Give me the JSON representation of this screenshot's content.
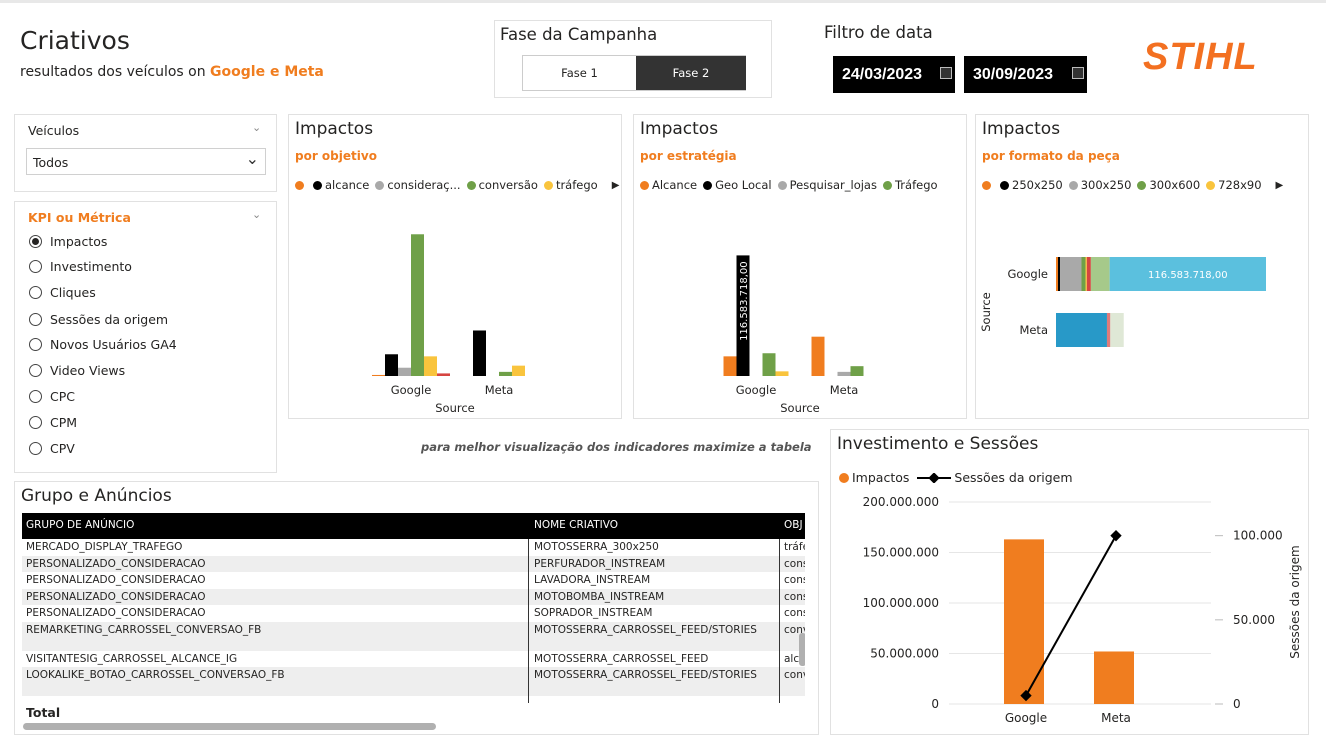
{
  "header": {
    "title": "Criativos",
    "subtitle_prefix": "resultados dos veículos on ",
    "subtitle_highlight": "Google e Meta",
    "logo": "STIHL"
  },
  "phase": {
    "title": "Fase da Campanha",
    "options": [
      "Fase 1",
      "Fase 2"
    ],
    "selected": "Fase 2"
  },
  "date_filter": {
    "title": "Filtro de data",
    "start": "24/03/2023",
    "end": "30/09/2023"
  },
  "vehicles_filter": {
    "label": "Veículos",
    "value": "Todos"
  },
  "kpi_filter": {
    "label": "KPI ou Métrica",
    "options": [
      "Impactos",
      "Investimento",
      "Cliques",
      "Sessões da origem",
      "Novos Usuários GA4",
      "Video Views",
      "CPC",
      "CPM",
      "CPV"
    ],
    "selected": "Impactos"
  },
  "chart_objetivo": {
    "title": "Impactos",
    "subtitle": "por objetivo",
    "legend": [
      "alcance",
      "consideraç...",
      "conversão",
      "tráfego"
    ],
    "legend_colors": [
      "#f07d1f",
      "#000000",
      "#a9a9a9",
      "#6fa048",
      "#f9c43d"
    ],
    "xlabel": "Source"
  },
  "chart_estrategia": {
    "title": "Impactos",
    "subtitle": "por estratégia",
    "legend": [
      "Alcance",
      "Geo Local",
      "Pesquisar_lojas",
      "Tráfego"
    ],
    "legend_colors": [
      "#f07d1f",
      "#000000",
      "#a9a9a9",
      "#6fa048"
    ],
    "xlabel": "Source",
    "data_label": "116.583.718,00"
  },
  "chart_formato": {
    "title": "Impactos",
    "subtitle": "por formato da peça",
    "legend": [
      "250x250",
      "300x250",
      "300x600",
      "728x90"
    ],
    "legend_colors": [
      "#f07d1f",
      "#000000",
      "#a9a9a9",
      "#6fa048",
      "#f9c43d"
    ],
    "ylabel": "Source",
    "data_label": "116.583.718,00"
  },
  "note": "para melhor visualização dos indicadores maximize a tabela",
  "chart_invest": {
    "title": "Investimento e Sessões",
    "legend_bar": "Impactos",
    "legend_line": "Sessões da origem",
    "y2label": "Sessões da origem",
    "yticks": [
      "200.000.000",
      "150.000.000",
      "100.000.000",
      "50.000.000",
      "0"
    ],
    "y2ticks": [
      "100.000",
      "50.000",
      "0"
    ]
  },
  "table": {
    "title": "Grupo e Anúncios",
    "columns": [
      "GRUPO DE ANÚNCIO",
      "NOME CRIATIVO",
      "OBJ"
    ],
    "rows": [
      [
        "MERCADO_DISPLAY_TRAFEGO",
        "MOTOSSERRA_300x250",
        "tráfe"
      ],
      [
        "PERSONALIZADO_CONSIDERACAO",
        "PERFURADOR_INSTREAM",
        "cons"
      ],
      [
        "PERSONALIZADO_CONSIDERACAO",
        "LAVADORA_INSTREAM",
        "cons"
      ],
      [
        "PERSONALIZADO_CONSIDERACAO",
        "MOTOBOMBA_INSTREAM",
        "cons"
      ],
      [
        "PERSONALIZADO_CONSIDERACAO",
        "SOPRADOR_INSTREAM",
        "cons"
      ],
      [
        "REMARKETING_CARROSSEL_CONVERSAO_FB",
        "MOTOSSERRA_CARROSSEL_FEED/STORIES",
        "conv"
      ],
      [
        "VISITANTESIG_CARROSSEL_ALCANCE_IG",
        "MOTOSSERRA_CARROSSEL_FEED",
        "alca"
      ],
      [
        "LOOKALIKE_BOTAO_CARROSSEL_CONVERSAO_FB",
        "MOTOSSERRA_CARROSSEL_FEED/STORIES",
        "conv"
      ]
    ],
    "total_label": "Total"
  },
  "chart_data": [
    {
      "type": "bar",
      "title": "Impactos",
      "subtitle": "por objetivo",
      "xlabel": "Source",
      "categories": [
        "Google",
        "Meta"
      ],
      "series": [
        {
          "name": "",
          "color": "#f07d1f",
          "values": [
            1000000,
            0
          ]
        },
        {
          "name": "alcance",
          "color": "#000000",
          "values": [
            21000000,
            44000000
          ]
        },
        {
          "name": "consideraç...",
          "color": "#a9a9a9",
          "values": [
            8000000,
            0
          ]
        },
        {
          "name": "conversão",
          "color": "#6fa048",
          "values": [
            137000000,
            4000000
          ]
        },
        {
          "name": "tráfego",
          "color": "#f9c43d",
          "values": [
            19000000,
            10000000
          ]
        },
        {
          "name": "",
          "color": "#d64541",
          "values": [
            2500000,
            0
          ]
        }
      ],
      "ylim": [
        0,
        145000000
      ]
    },
    {
      "type": "bar",
      "title": "Impactos",
      "subtitle": "por estratégia",
      "xlabel": "Source",
      "categories": [
        "Google",
        "Meta"
      ],
      "series": [
        {
          "name": "Alcance",
          "color": "#f07d1f",
          "values": [
            19000000,
            38000000
          ]
        },
        {
          "name": "Geo Local",
          "color": "#000000",
          "values": [
            116583718,
            0
          ]
        },
        {
          "name": "Pesquisar_lojas",
          "color": "#a9a9a9",
          "values": [
            0,
            4000000
          ]
        },
        {
          "name": "Tráfego",
          "color": "#6fa048",
          "values": [
            22000000,
            9500000
          ]
        },
        {
          "name": "",
          "color": "#f9c43d",
          "values": [
            4500000,
            0
          ]
        }
      ],
      "ylim": [
        0,
        145000000
      ],
      "data_labels": [
        "116.583.718,00"
      ]
    },
    {
      "type": "bar",
      "orientation": "horizontal-stacked",
      "title": "Impactos",
      "subtitle": "por formato da peça",
      "ylabel": "Source",
      "categories": [
        "Google",
        "Meta"
      ],
      "series": [
        {
          "name": "",
          "color": "#f07d1f",
          "values": [
            1500000,
            0
          ]
        },
        {
          "name": "250x250",
          "color": "#000000",
          "values": [
            1500000,
            0
          ]
        },
        {
          "name": "300x250",
          "color": "#a9a9a9",
          "values": [
            16000000,
            0
          ]
        },
        {
          "name": "300x600",
          "color": "#6fa048",
          "values": [
            3000000,
            0
          ]
        },
        {
          "name": "728x90",
          "color": "#f9c43d",
          "values": [
            1000000,
            0
          ]
        },
        {
          "name": "",
          "color": "#d64541",
          "values": [
            3000000,
            0
          ]
        },
        {
          "name": "",
          "color": "#a6c98a",
          "values": [
            14000000,
            0
          ]
        },
        {
          "name": "",
          "color": "#5bc0de",
          "values": [
            116583718,
            0
          ]
        },
        {
          "name": "",
          "color": "#2899c8",
          "values": [
            0,
            38000000
          ]
        },
        {
          "name": "",
          "color": "#e07b7b",
          "values": [
            0,
            2500000
          ]
        },
        {
          "name": "",
          "color": "#dfe8d6",
          "values": [
            0,
            10000000
          ]
        }
      ],
      "data_labels": [
        "116.583.718,00"
      ]
    },
    {
      "type": "bar",
      "title": "Investimento e Sessões",
      "categories": [
        "Google",
        "Meta"
      ],
      "series": [
        {
          "name": "Impactos",
          "type": "bar",
          "color": "#f07d1f",
          "values": [
            163000000,
            52000000
          ]
        },
        {
          "name": "Sessões da origem",
          "type": "line",
          "color": "#000000",
          "axis": "right",
          "values": [
            5000,
            100000
          ]
        }
      ],
      "ylim": [
        0,
        200000000
      ],
      "y2lim": [
        0,
        120000
      ],
      "y2label": "Sessões da origem"
    }
  ]
}
